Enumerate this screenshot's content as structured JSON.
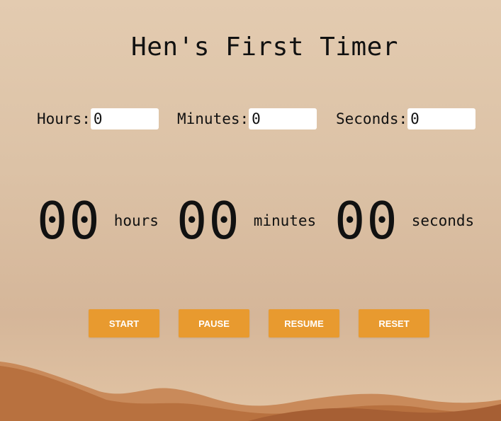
{
  "title": "Hen's First Timer",
  "inputs": {
    "hours": {
      "label": "Hours:",
      "value": "0"
    },
    "minutes": {
      "label": "Minutes:",
      "value": "0"
    },
    "seconds": {
      "label": "Seconds:",
      "value": "0"
    }
  },
  "display": {
    "hours": {
      "digits": "00",
      "label": "hours"
    },
    "minutes": {
      "digits": "00",
      "label": "minutes"
    },
    "seconds": {
      "digits": "00",
      "label": "seconds"
    }
  },
  "buttons": {
    "start": "START",
    "pause": "PAUSE",
    "resume": "RESUME",
    "reset": "RESET"
  },
  "colors": {
    "button": "#e89a2f",
    "button_text": "#ffffff",
    "background": "#dcc2a6",
    "dune": "#b86d3d"
  }
}
